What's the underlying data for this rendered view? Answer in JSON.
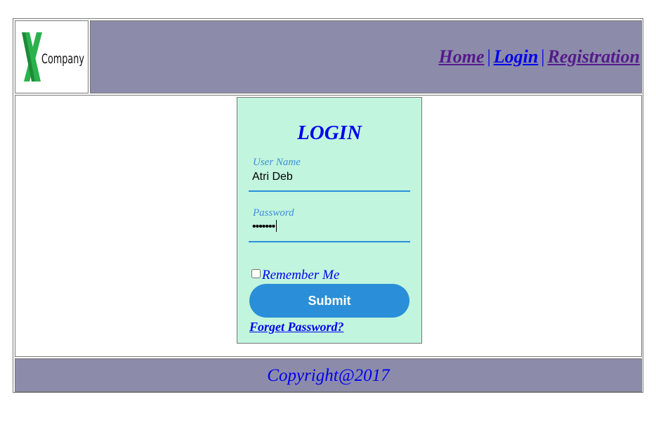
{
  "header": {
    "logo_text": "Company",
    "nav": {
      "home": "Home",
      "login": "Login",
      "registration": "Registration",
      "separator": "|"
    }
  },
  "login": {
    "title": "LOGIN",
    "username": {
      "label": "User Name",
      "value": "Atri Deb"
    },
    "password": {
      "label": "Password",
      "masked_value": "•••••••"
    },
    "remember_label": "Remember Me",
    "remember_checked": false,
    "submit_label": "Submit",
    "forgot_label": "Forget Password?"
  },
  "footer": {
    "copyright": "Copyright@2017"
  },
  "colors": {
    "header_bg": "#8c8caa",
    "login_bg": "#c1f5de",
    "accent_blue": "#2a8fd8",
    "link_blue": "#0000ee",
    "visited_purple": "#551a8b",
    "logo_green": "#2bb24c"
  }
}
